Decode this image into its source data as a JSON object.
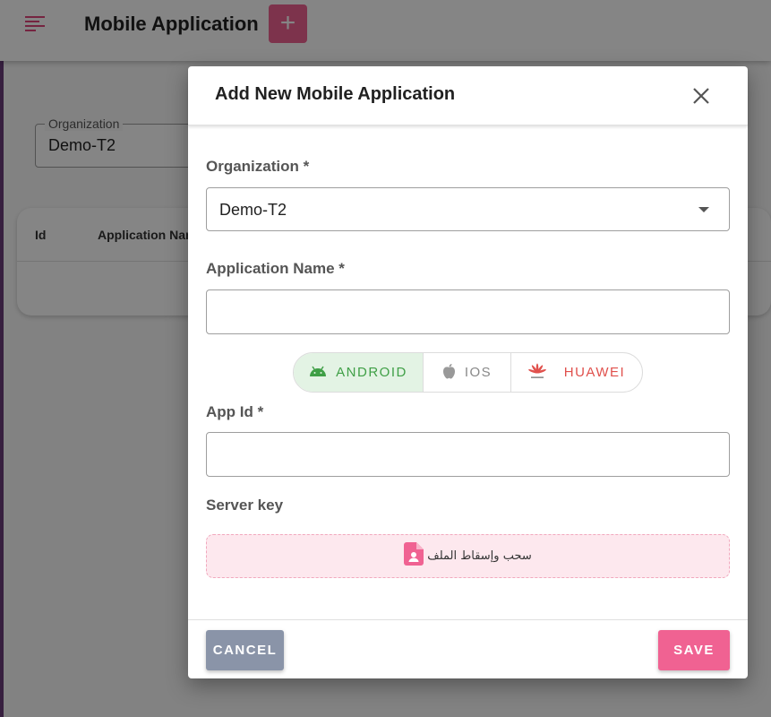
{
  "background": {
    "page_title": "Mobile Application",
    "add_button": "+",
    "org_filter": {
      "label": "Organization",
      "value": "Demo-T2"
    },
    "table": {
      "columns": [
        "Id",
        "Application Nam"
      ]
    }
  },
  "dialog": {
    "title": "Add New Mobile Application",
    "organization": {
      "label": "Organization *",
      "value": "Demo-T2"
    },
    "application_name": {
      "label": "Application Name *",
      "value": ""
    },
    "platforms": [
      {
        "label": "ANDROID",
        "icon": "android-icon",
        "selected": true
      },
      {
        "label": "IOS",
        "icon": "apple-icon",
        "selected": false
      },
      {
        "label": "HUAWEI",
        "icon": "huawei-icon",
        "selected": false
      }
    ],
    "app_id": {
      "label": "App Id *",
      "value": ""
    },
    "server_key": {
      "label": "Server key",
      "dropzone_text": "سحب وإسقاط الملف"
    },
    "buttons": {
      "cancel": "CANCEL",
      "save": "SAVE"
    }
  },
  "colors": {
    "accent": "#f06292",
    "android_green": "#3f9f46",
    "huawei_red": "#e0504c",
    "cancel_gray": "#8a94a8"
  }
}
